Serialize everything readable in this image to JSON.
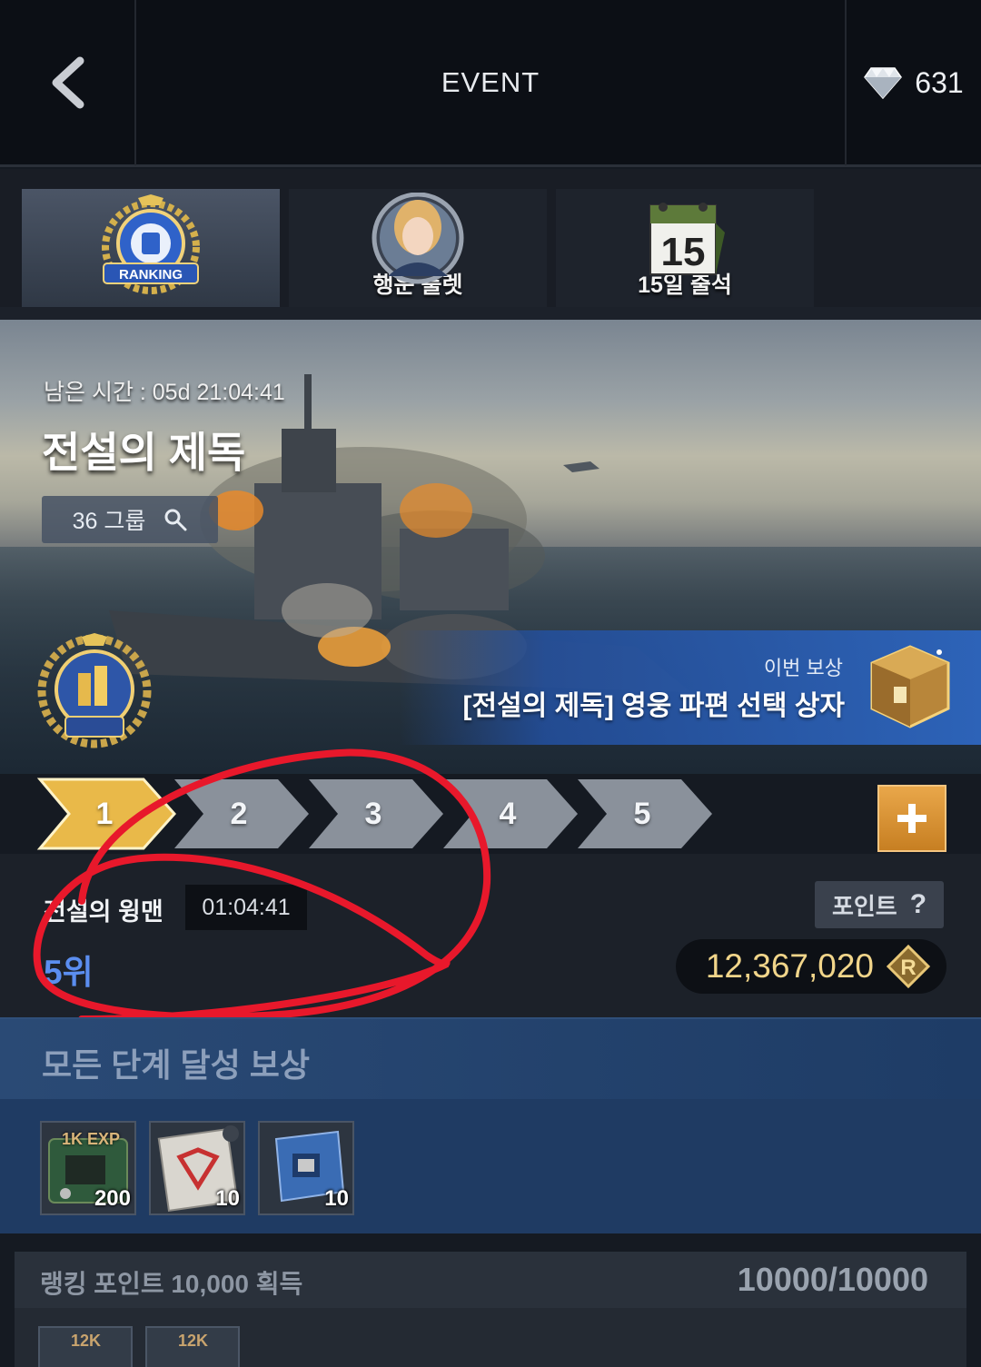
{
  "header": {
    "title": "EVENT",
    "currency_amount": "631"
  },
  "tabs": [
    {
      "label": "",
      "icon": "ranking-emblem-icon",
      "active": true
    },
    {
      "label": "행운 룰렛",
      "icon": "pilot-portrait-icon",
      "active": false
    },
    {
      "label": "15일 출석",
      "icon": "calendar-15-icon",
      "active": false
    }
  ],
  "banner": {
    "remaining_time": "남은 시간 : 05d 21:04:41",
    "event_title": "전설의 제독",
    "group_label": "36 그룹",
    "reward_caption": "이번 보상",
    "reward_name": "[전설의 제독] 영웅 파편 선택 상자"
  },
  "stages": [
    "1",
    "2",
    "3",
    "4",
    "5"
  ],
  "stage_info": {
    "stage_name": "전설의 윙맨",
    "timer": "01:04:41",
    "rank": "5위",
    "points_label": "포인트",
    "points_value": "12,367,020"
  },
  "all_reward": {
    "title": "모든 단계 달성 보상",
    "items": [
      {
        "tag": "1K EXP",
        "count": "200",
        "icon": "exp-chip-icon"
      },
      {
        "tag": "",
        "count": "10",
        "icon": "blueprint-icon"
      },
      {
        "tag": "",
        "count": "10",
        "icon": "circuit-board-icon"
      }
    ]
  },
  "mission": {
    "title": "랭킹 포인트 10,000 획득",
    "progress": "10000/10000",
    "items": [
      {
        "tag": "12K"
      },
      {
        "tag": "12K"
      }
    ]
  },
  "colors": {
    "accent_gold": "#e9b949",
    "rank_blue": "#5b8ef0",
    "annotation_red": "#e8182b"
  }
}
